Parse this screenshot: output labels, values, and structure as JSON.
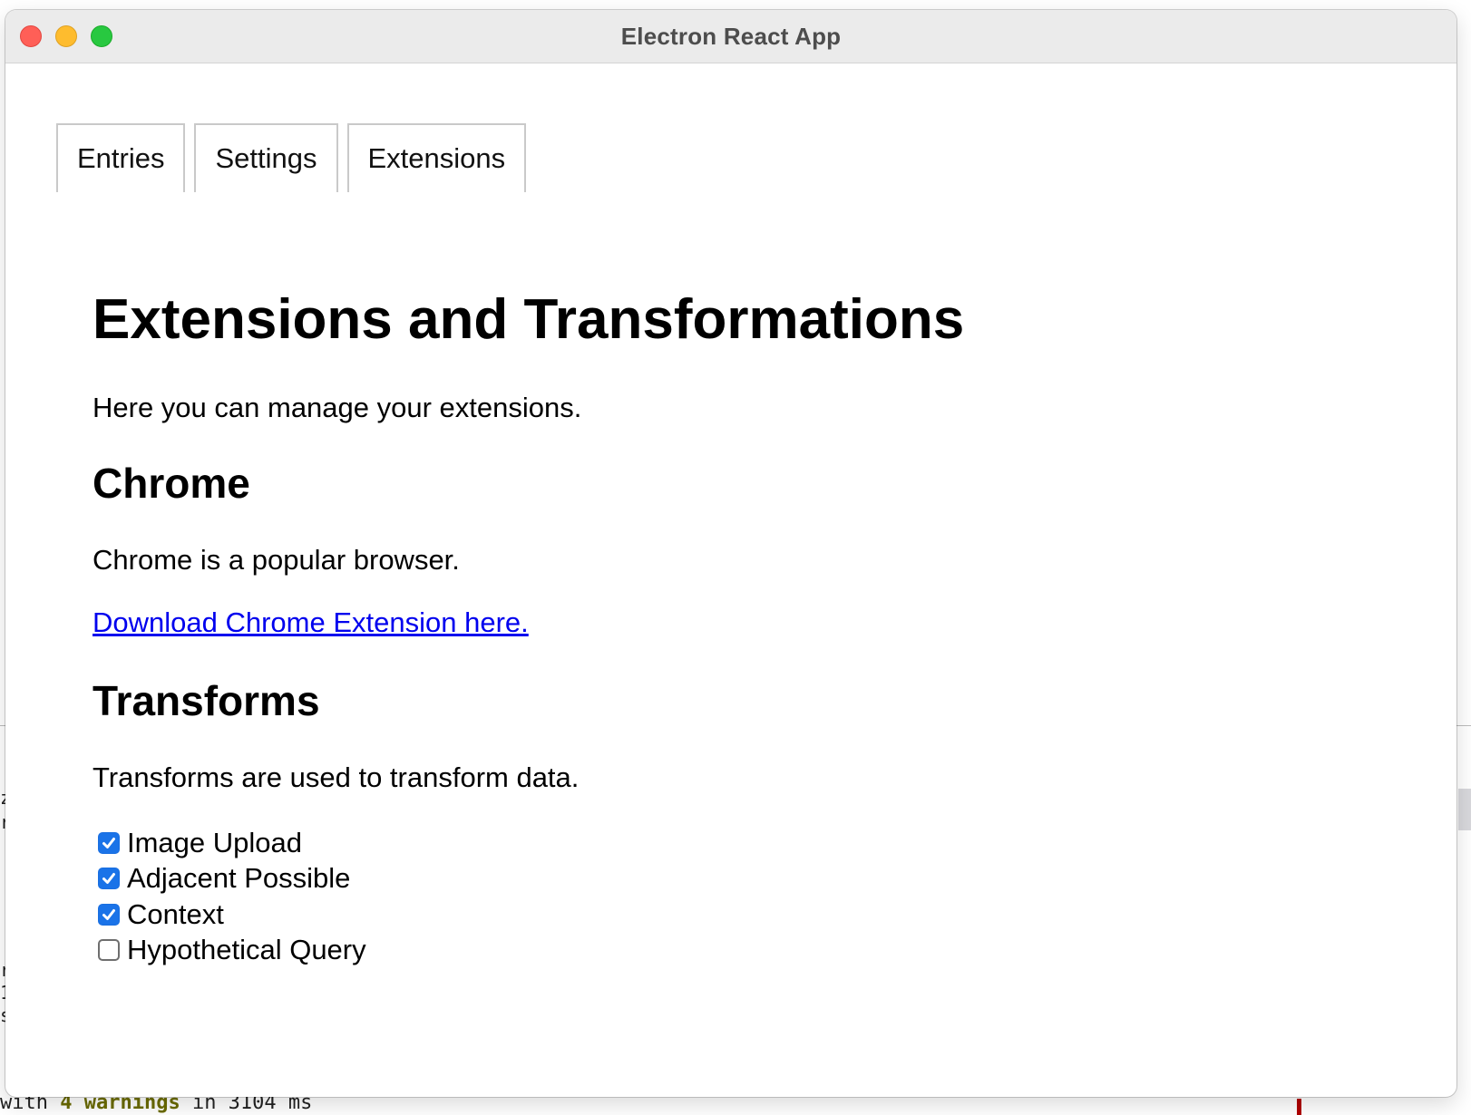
{
  "background": {
    "terminal_bottom_line": {
      "prefix": "with ",
      "count": "4",
      "word": "warnings",
      "suffix": " in 3104 ms"
    },
    "edge_chars": [
      "z",
      "r",
      "r",
      "1",
      "s"
    ]
  },
  "window": {
    "title": "Electron React App"
  },
  "tabs": [
    {
      "label": "Entries"
    },
    {
      "label": "Settings"
    },
    {
      "label": "Extensions"
    }
  ],
  "page": {
    "title": "Extensions and Transformations",
    "intro": "Here you can manage your extensions.",
    "chrome": {
      "heading": "Chrome",
      "description": "Chrome is a popular browser.",
      "link_text": "Download Chrome Extension here."
    },
    "transforms": {
      "heading": "Transforms",
      "description": "Transforms are used to transform data.",
      "items": [
        {
          "label": "Image Upload",
          "checked": true
        },
        {
          "label": "Adjacent Possible",
          "checked": true
        },
        {
          "label": "Context",
          "checked": true
        },
        {
          "label": "Hypothetical Query",
          "checked": false
        }
      ]
    }
  },
  "colors": {
    "checkbox_checked": "#1a73e8",
    "link": "#0000ee",
    "close": "#ff5f57",
    "minimize": "#febc2e",
    "zoom": "#28c840"
  }
}
